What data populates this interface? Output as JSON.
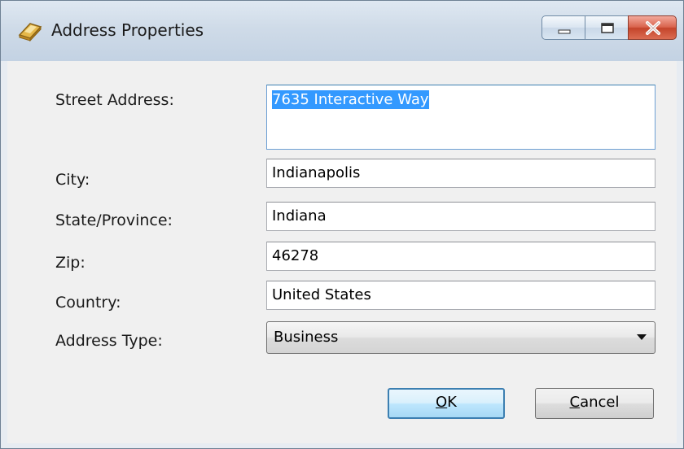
{
  "window": {
    "title": "Address Properties"
  },
  "icons": {
    "app_icon": "address-book-icon",
    "minimize": "minimize-icon",
    "maximize": "maximize-icon",
    "close": "close-icon",
    "dropdown": "chevron-down-icon"
  },
  "form": {
    "street": {
      "label": "Street Address:",
      "value": "7635 Interactive Way"
    },
    "city": {
      "label": "City:",
      "value": "Indianapolis"
    },
    "state": {
      "label": "State/Province:",
      "value": "Indiana"
    },
    "zip": {
      "label": "Zip:",
      "value": "46278"
    },
    "country": {
      "label": "Country:",
      "value": "United States"
    },
    "address_type": {
      "label": "Address Type:",
      "value": "Business"
    }
  },
  "buttons": {
    "ok": {
      "accel": "O",
      "rest": "K"
    },
    "cancel": {
      "accel": "C",
      "rest": "ancel"
    }
  },
  "colors": {
    "selection": "#3399ff",
    "close_button": "#c4442b"
  }
}
